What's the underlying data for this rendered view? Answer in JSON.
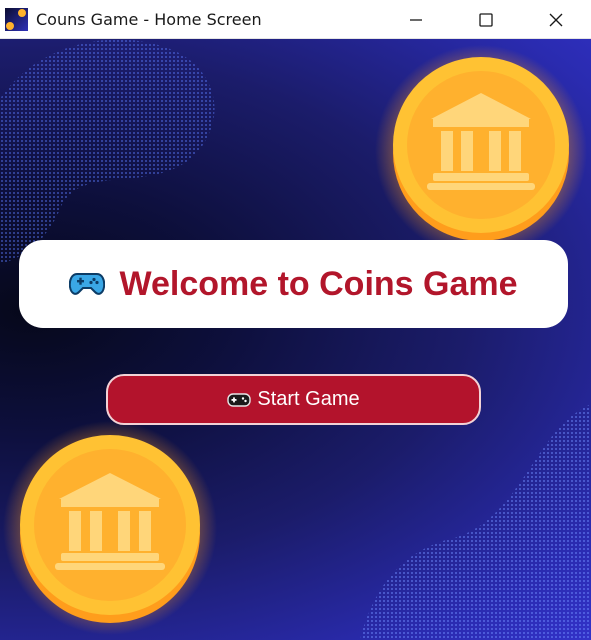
{
  "window": {
    "title": "Couns Game - Home Screen",
    "app_icon": "app-icon",
    "controls": {
      "minimize_icon": "minimize-icon",
      "maximize_icon": "maximize-icon",
      "close_icon": "close-icon"
    }
  },
  "home": {
    "welcome_icon": "gamepad-icon",
    "welcome_text": "Welcome to Coins Game",
    "start_button": {
      "icon": "gamepad-icon",
      "label": "Start Game"
    },
    "decorations": [
      "coin-bank-icon",
      "coin-bank-icon"
    ]
  },
  "colors": {
    "accent_red": "#b2162b",
    "button_red": "#b3132c",
    "coin_gold": "#ffc233",
    "background_deep": "#0d0f3b",
    "background_blue": "#3232c8"
  }
}
